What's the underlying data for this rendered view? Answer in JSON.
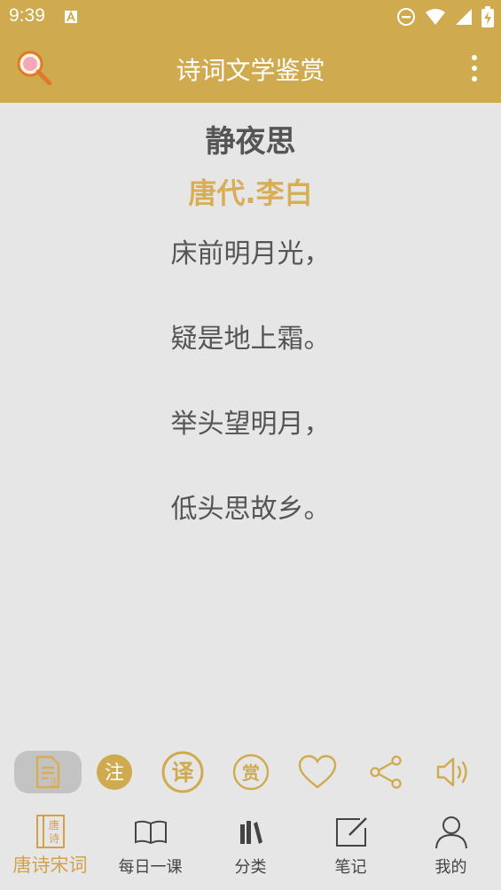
{
  "status": {
    "time": "9:39"
  },
  "app": {
    "title": "诗词文学鉴赏"
  },
  "poem": {
    "title": "静夜思",
    "author": "唐代.李白",
    "lines": [
      "床前明月光，",
      "疑是地上霜。",
      "举头望明月，",
      "低头思故乡。"
    ]
  },
  "tools": {
    "original_icon_text": "正",
    "notes_label": "注",
    "translate_label": "译",
    "appreciate_label": "赏"
  },
  "nav": {
    "items": [
      {
        "label": "唐诗宋词",
        "icon_text_top": "唐",
        "icon_text_bottom": "诗"
      },
      {
        "label": "每日一课"
      },
      {
        "label": "分类"
      },
      {
        "label": "笔记"
      },
      {
        "label": "我的"
      }
    ]
  },
  "colors": {
    "accent": "#cfaa4f",
    "gold_text": "#d9ad55",
    "background": "#e6e6e6"
  }
}
